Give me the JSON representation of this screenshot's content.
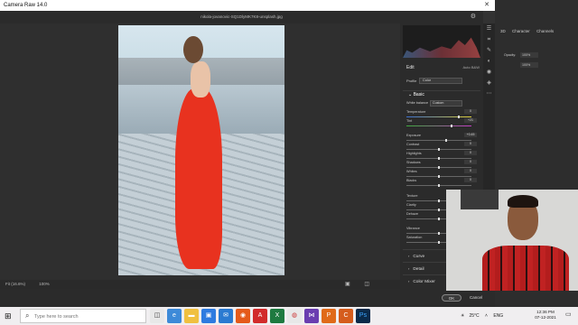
{
  "window": {
    "title": "Camera Raw 14.0",
    "filename": "nikola-jovanovic-SQ1DlyMK7K8-unsplash.jpg"
  },
  "canvas": {
    "zoom_label": "Fit (16.6%)",
    "zoom_percent": "100%"
  },
  "buttons": {
    "ok": "OK",
    "cancel": "Cancel"
  },
  "panel": {
    "title": "Edit",
    "auto_label": "Auto",
    "bw_label": "B&W",
    "profile_label": "Profile",
    "profile_value": "Color",
    "basic_label": "Basic",
    "wb_label": "White balance",
    "wb_value": "Custom",
    "sliders": [
      {
        "label": "Temperature",
        "value": "0",
        "level": 0.82,
        "kind": "temp"
      },
      {
        "label": "Tint",
        "value": "+21",
        "level": 0.7,
        "kind": "tint"
      },
      {
        "label": "Exposure",
        "value": "+0.45",
        "level": 0.62,
        "kind": "plain"
      },
      {
        "label": "Contrast",
        "value": "0",
        "level": 0.5,
        "kind": "plain"
      },
      {
        "label": "Highlights",
        "value": "0",
        "level": 0.5,
        "kind": "plain"
      },
      {
        "label": "Shadows",
        "value": "0",
        "level": 0.5,
        "kind": "plain"
      },
      {
        "label": "Whites",
        "value": "0",
        "level": 0.5,
        "kind": "plain"
      },
      {
        "label": "Blacks",
        "value": "0",
        "level": 0.5,
        "kind": "plain"
      },
      {
        "label": "Texture",
        "value": "0",
        "level": 0.5,
        "kind": "plain"
      },
      {
        "label": "Clarity",
        "value": "0",
        "level": 0.5,
        "kind": "plain"
      },
      {
        "label": "Dehaze",
        "value": "0",
        "level": 0.5,
        "kind": "plain"
      },
      {
        "label": "Vibrance",
        "value": "0",
        "level": 0.5,
        "kind": "plain"
      },
      {
        "label": "Saturation",
        "value": "0",
        "level": 0.5,
        "kind": "plain"
      }
    ],
    "sections": [
      "Curve",
      "Detail",
      "Color Mixer"
    ]
  },
  "photoshop": {
    "tab_3d": "3D",
    "tab_character": "Character",
    "tab_channels": "Channels",
    "opacity_label": "Opacity:",
    "opacity_value": "100%",
    "fill_value": "100%"
  },
  "taskbar": {
    "search_placeholder": "Type here to search",
    "weather": "25°C",
    "language": "ENG",
    "time": "12:36 PM",
    "date": "07-12-2021"
  }
}
